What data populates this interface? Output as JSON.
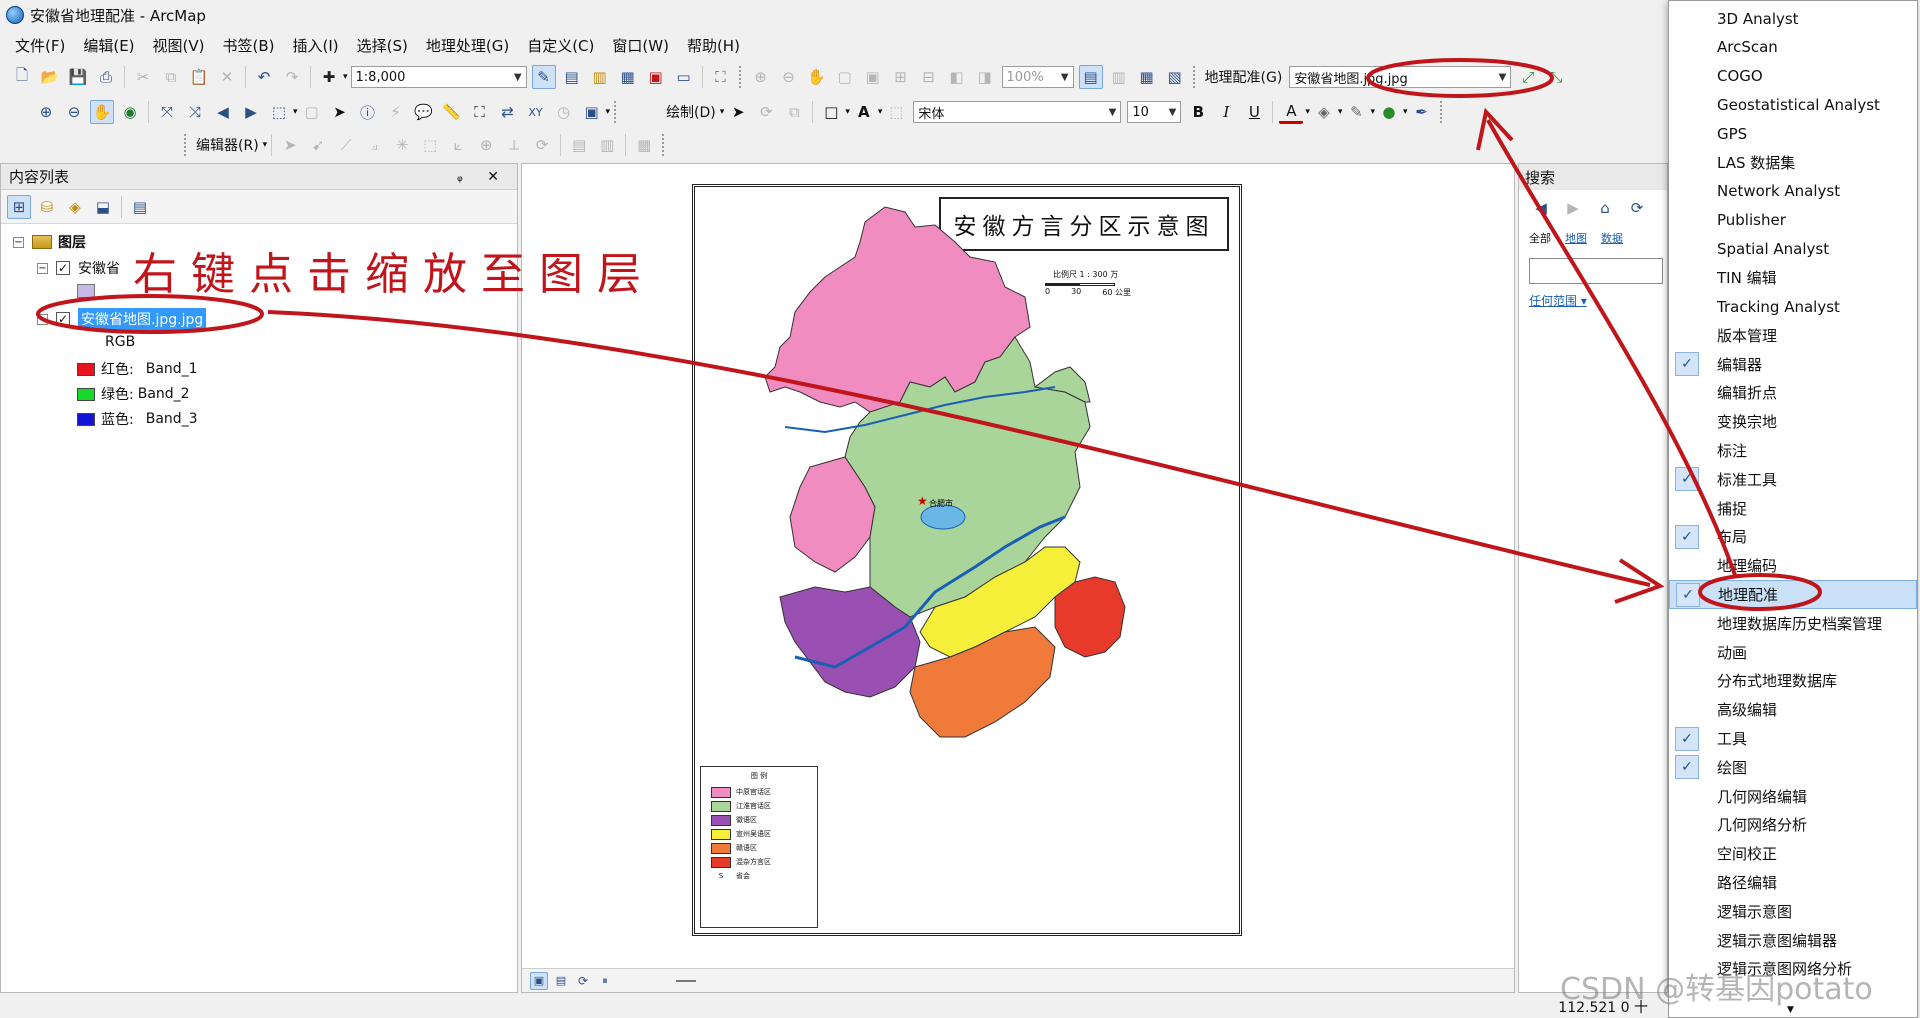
{
  "window": {
    "title": "安徽省地理配准 - ArcMap"
  },
  "menu": [
    "文件(F)",
    "编辑(E)",
    "视图(V)",
    "书签(B)",
    "插入(I)",
    "选择(S)",
    "地理处理(G)",
    "自定义(C)",
    "窗口(W)",
    "帮助(H)"
  ],
  "toolbar": {
    "scale": "1:8,000",
    "zoom_pct": "100%",
    "georef_label": "地理配准(G)",
    "georef_layer": "安徽省地图.jpg.jpg",
    "draw_label": "绘制(D)",
    "font_name": "宋体",
    "font_size": "10",
    "bold": "B",
    "italic": "I",
    "underline": "U",
    "editor_label": "编辑器(R)"
  },
  "toc": {
    "title": "内容列表",
    "pin": "ᵩ ✕",
    "root": "图层",
    "layer1": "安徽省",
    "layer2": "安徽省地图.jpg.jpg",
    "rgb": "RGB",
    "bands": [
      {
        "label": "红色:",
        "band": "Band_1",
        "color": "#e8141c"
      },
      {
        "label": "绿色:",
        "band": "Band_2",
        "color": "#18d92b"
      },
      {
        "label": "蓝色:",
        "band": "Band_3",
        "color": "#1414d6"
      }
    ]
  },
  "annotation": {
    "text": "右键点击缩放至图层",
    "color": "#c0151b"
  },
  "map": {
    "title": "安徽方言分区示意图",
    "scale_text": "比例尺 1 : 300 万",
    "scale_ticks": [
      "0",
      "30",
      "60 公里"
    ],
    "capital": "合肥市",
    "legend_title": "图 例",
    "legend": [
      {
        "label": "中原官话区",
        "color": "#f08cc0"
      },
      {
        "label": "江淮官话区",
        "color": "#a9d49a"
      },
      {
        "label": "徽语区",
        "color": "#9a4fb3"
      },
      {
        "label": "宣州吴语区",
        "color": "#f5ef3a"
      },
      {
        "label": "赣语区",
        "color": "#f07a3a"
      },
      {
        "label": "混杂方言区",
        "color": "#e83a2a"
      }
    ],
    "legend_capital": "省会"
  },
  "search": {
    "title": "搜索",
    "links": [
      "全部",
      "地图",
      "数据"
    ],
    "any": "任何范围 ▾"
  },
  "menu_items": [
    {
      "label": "3D Analyst",
      "checked": false
    },
    {
      "label": "ArcScan",
      "checked": false
    },
    {
      "label": "COGO",
      "checked": false
    },
    {
      "label": "Geostatistical Analyst",
      "checked": false
    },
    {
      "label": "GPS",
      "checked": false
    },
    {
      "label": "LAS 数据集",
      "checked": false
    },
    {
      "label": "Network Analyst",
      "checked": false
    },
    {
      "label": "Publisher",
      "checked": false
    },
    {
      "label": "Spatial Analyst",
      "checked": false
    },
    {
      "label": "TIN 编辑",
      "checked": false
    },
    {
      "label": "Tracking Analyst",
      "checked": false
    },
    {
      "label": "版本管理",
      "checked": false
    },
    {
      "label": "编辑器",
      "checked": true
    },
    {
      "label": "编辑折点",
      "checked": false
    },
    {
      "label": "变换宗地",
      "checked": false
    },
    {
      "label": "标注",
      "checked": false
    },
    {
      "label": "标准工具",
      "checked": true
    },
    {
      "label": "捕捉",
      "checked": false
    },
    {
      "label": "布局",
      "checked": true
    },
    {
      "label": "地理编码",
      "checked": false
    },
    {
      "label": "地理配准",
      "checked": true,
      "highlight": true
    },
    {
      "label": "地理数据库历史档案管理",
      "checked": false
    },
    {
      "label": "动画",
      "checked": false
    },
    {
      "label": "分布式地理数据库",
      "checked": false
    },
    {
      "label": "高级编辑",
      "checked": false
    },
    {
      "label": "工具",
      "checked": true
    },
    {
      "label": "绘图",
      "checked": true
    },
    {
      "label": "几何网络编辑",
      "checked": false
    },
    {
      "label": "几何网络分析",
      "checked": false
    },
    {
      "label": "空间校正",
      "checked": false
    },
    {
      "label": "路径编辑",
      "checked": false
    },
    {
      "label": "逻辑示意图",
      "checked": false
    },
    {
      "label": "逻辑示意图编辑器",
      "checked": false
    },
    {
      "label": "逻辑示意图网络分析",
      "checked": false
    }
  ],
  "status": {
    "coords": "112.521  0 十",
    "watermark": "CSDN @转基因potato"
  }
}
